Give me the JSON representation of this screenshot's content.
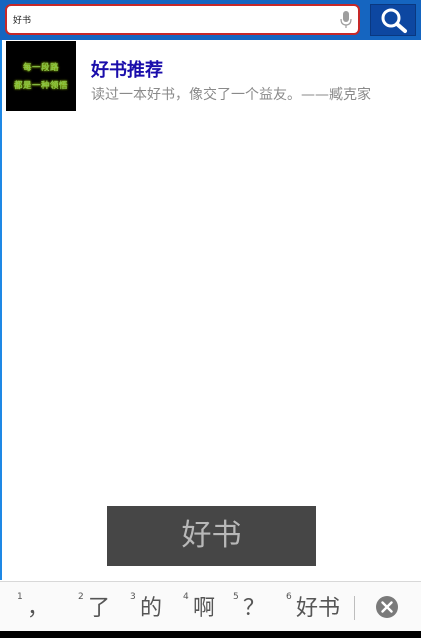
{
  "search": {
    "value": "好书",
    "mic_icon": "microphone-icon",
    "button_icon": "search-icon"
  },
  "results": [
    {
      "title": "好书推荐",
      "description": "读过一本好书，像交了一个益友。——臧克家",
      "thumbnail_lines": [
        "每一段路",
        "都是一种领悟"
      ]
    }
  ],
  "ime": {
    "preview": "好书",
    "candidates": [
      {
        "num": "1",
        "text": "，"
      },
      {
        "num": "2",
        "text": "了"
      },
      {
        "num": "3",
        "text": "的"
      },
      {
        "num": "4",
        "text": "啊"
      },
      {
        "num": "5",
        "text": "？"
      },
      {
        "num": "6",
        "text": "好书"
      }
    ],
    "close_icon": "close-icon"
  },
  "colors": {
    "topbar": "#1565c0",
    "search_border": "#c62828",
    "title_link": "#1a0dab"
  }
}
